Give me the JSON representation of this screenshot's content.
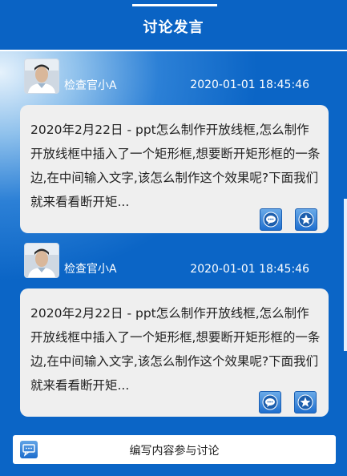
{
  "header": {
    "title": "讨论发言"
  },
  "posts": [
    {
      "author": "检查官小A",
      "time": "2020-01-01 18:45:46",
      "content": "2020年2月22日 - ppt怎么制作开放线框,怎么制作开放线框中插入了一个矩形框,想要断开矩形框的一条边,在中间输入文字,该怎么制作这个效果呢?下面我们就来看看断开矩..."
    },
    {
      "author": "检查官小A",
      "time": "2020-01-01 18:45:46",
      "content": "2020年2月22日 - ppt怎么制作开放线框,怎么制作开放线框中插入了一个矩形框,想要断开矩形框的一条边,在中间输入文字,该怎么制作这个效果呢?下面我们就来看看断开矩..."
    }
  ],
  "compose": {
    "label": "编写内容参与讨论"
  },
  "icons": {
    "comment": "chat-bubble-icon",
    "favorite": "star-icon",
    "compose": "chat-bubble-icon",
    "avatar": "user-avatar"
  },
  "colors": {
    "primary": "#0a63c4",
    "bubble": "#efefef",
    "text": "#222222"
  }
}
